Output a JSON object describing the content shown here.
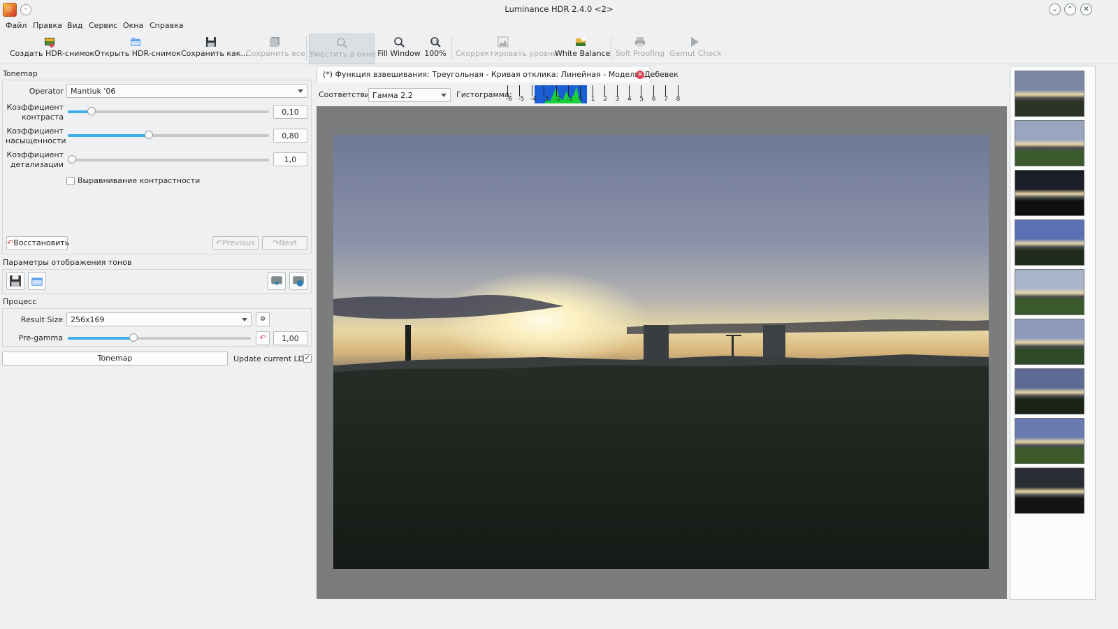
{
  "window": {
    "title": "Luminance HDR 2.4.0 <2>",
    "menu_glyph": "–",
    "min_glyph": "⌄",
    "max_glyph": "⌃",
    "close_glyph": "✕"
  },
  "menubar": {
    "items": [
      "Файл",
      "Правка",
      "Вид",
      "Сервис",
      "Окна",
      "Справка"
    ]
  },
  "toolbar": {
    "create_hdr": "Создать HDR-снимок",
    "open_hdr": "Открыть HDR-снимок",
    "save_as": "Сохранить как...",
    "save_all": "Сохранить все",
    "fit_window": "Уместить в окне",
    "fill_window": "Fill Window",
    "zoom_100": "100%",
    "adjust_levels": "Скорректировать уровни",
    "white_balance": "White Balance",
    "soft_proofing": "Soft Proofing",
    "gamut_check": "Gamut Check"
  },
  "tonemap": {
    "title": "Tonemap",
    "operator_label": "Operator",
    "operator_value": "Mantiuk '06",
    "contrast_label": "Коэффициент контраста",
    "contrast_value": "0,10",
    "contrast_level": 0.1,
    "saturation_label": "Коэффициент насыщенности",
    "saturation_value": "0,80",
    "saturation_level": 0.4,
    "detail_label": "Коэффициент детализации",
    "detail_value": "1,0",
    "detail_level": 0.0,
    "equalize_label": "Выравнивание контрастности",
    "equalize_checked": false,
    "restore_label": "Восстановить",
    "previous_label": "Previous",
    "next_label": "Next"
  },
  "tone_params": {
    "title": "Параметры отображения тонов"
  },
  "process": {
    "title": "Процесс",
    "result_size_label": "Result Size",
    "result_size_value": "256x169",
    "pregamma_label": "Pre-gamma",
    "pregamma_value": "1,00",
    "pregamma_level": 0.35,
    "tonemap_button": "Tonemap",
    "update_ldr_label": "Update current LDR",
    "update_ldr_check": "✓"
  },
  "tab": {
    "title": "(*) Функция взвешивания: Треугольная - Кривая отклика: Линейная - Модель: Дебевек",
    "close_glyph": "✕"
  },
  "viewer": {
    "mapping_label": "Соответствие:",
    "mapping_value": "Гамма 2.2",
    "histogram_label": "Гистограмма:",
    "histogram_ticks": [
      "-6",
      "-5",
      "-4",
      "-3",
      "-2",
      "-1",
      "0",
      "1",
      "2",
      "3",
      "4",
      "5",
      "6",
      "7",
      "8"
    ]
  },
  "colors": {
    "accent": "#3daee9",
    "histogram_bg": "#1a5fd6",
    "histogram_fill": "#19d23a",
    "restore_icon": "#da4453"
  },
  "icons": {
    "create": "create-hdr-icon",
    "open": "open-hdr-icon",
    "save": "save-icon",
    "zoom": "zoom-icon"
  },
  "thumbnails": {
    "count": 9
  }
}
